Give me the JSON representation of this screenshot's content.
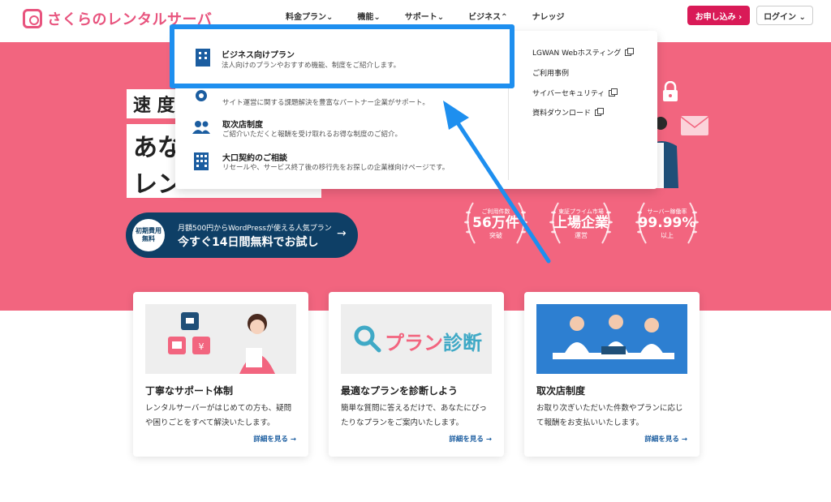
{
  "brand": {
    "name": "さくらのレンタルサーバ",
    "color": "#e8547e"
  },
  "nav": {
    "items": [
      "料金プラン⌄",
      "機能⌄",
      "サポート⌄",
      "ビジネス⌃",
      "ナレッジ"
    ],
    "apply_label": "お申し込み ›",
    "login_label": "ログイン ⌄"
  },
  "hero": {
    "tag": "速 度 ",
    "headline_1": "あな",
    "headline_2": "レン",
    "trial_badge_1": "初期費用",
    "trial_badge_2": "無料",
    "trial_sub": "月額500円からWordPressが使える人気プラン",
    "trial_main": "今すぐ14日間無料でお試し",
    "trial_arrow": "→",
    "stats": [
      {
        "line1": "ご利用件数",
        "line2": "56万件",
        "line3": "突破"
      },
      {
        "line1": "東証プライム市場",
        "line2": "上場企業",
        "line3": "運営"
      },
      {
        "line1": "サーバー稼働率",
        "line2": "99.99%",
        "line3": "以上"
      }
    ],
    "background_color": "#f2657f"
  },
  "dropdown": {
    "highlighted": {
      "title": "ビジネス向けプラン",
      "desc": "法人向けのプランやおすすめ機能、制度をご紹介します。"
    },
    "items": [
      {
        "title": "",
        "desc": "サイト運営に関する課題解決を豊富なパートナー企業がサポート。",
        "icon": "gear-icon"
      },
      {
        "title": "取次店制度",
        "desc": "ご紹介いただくと報酬を受け取れるお得な制度のご紹介。",
        "icon": "users-icon"
      },
      {
        "title": "大口契約のご相談",
        "desc": "リセールや、サービス終了後の移行先をお探しの企業様向けページです。",
        "icon": "building-icon"
      }
    ],
    "right_links": [
      {
        "label": "LGWAN Webホスティング",
        "external": true
      },
      {
        "label": "ご利用事例",
        "external": false
      },
      {
        "label": "サイバーセキュリティ",
        "external": true
      },
      {
        "label": "資料ダウンロード",
        "external": true
      }
    ],
    "highlight_color": "#1e8fef"
  },
  "cards": [
    {
      "title": "丁寧なサポート体制",
      "text": "レンタルサーバーがはじめての方も、疑問や困りごとをすべて解決いたします。",
      "link": "詳細を見る →"
    },
    {
      "title": "最適なプランを診断しよう",
      "text": "簡単な質問に答えるだけで、あなたにぴったりなプランをご案内いたします。",
      "link": "詳細を見る →",
      "image_text_1": "プラン",
      "image_text_2": "診断"
    },
    {
      "title": "取次店制度",
      "text": "お取り次ぎいただいた件数やプランに応じて報酬をお支払いいたします。",
      "link": "詳細を見る →"
    }
  ]
}
